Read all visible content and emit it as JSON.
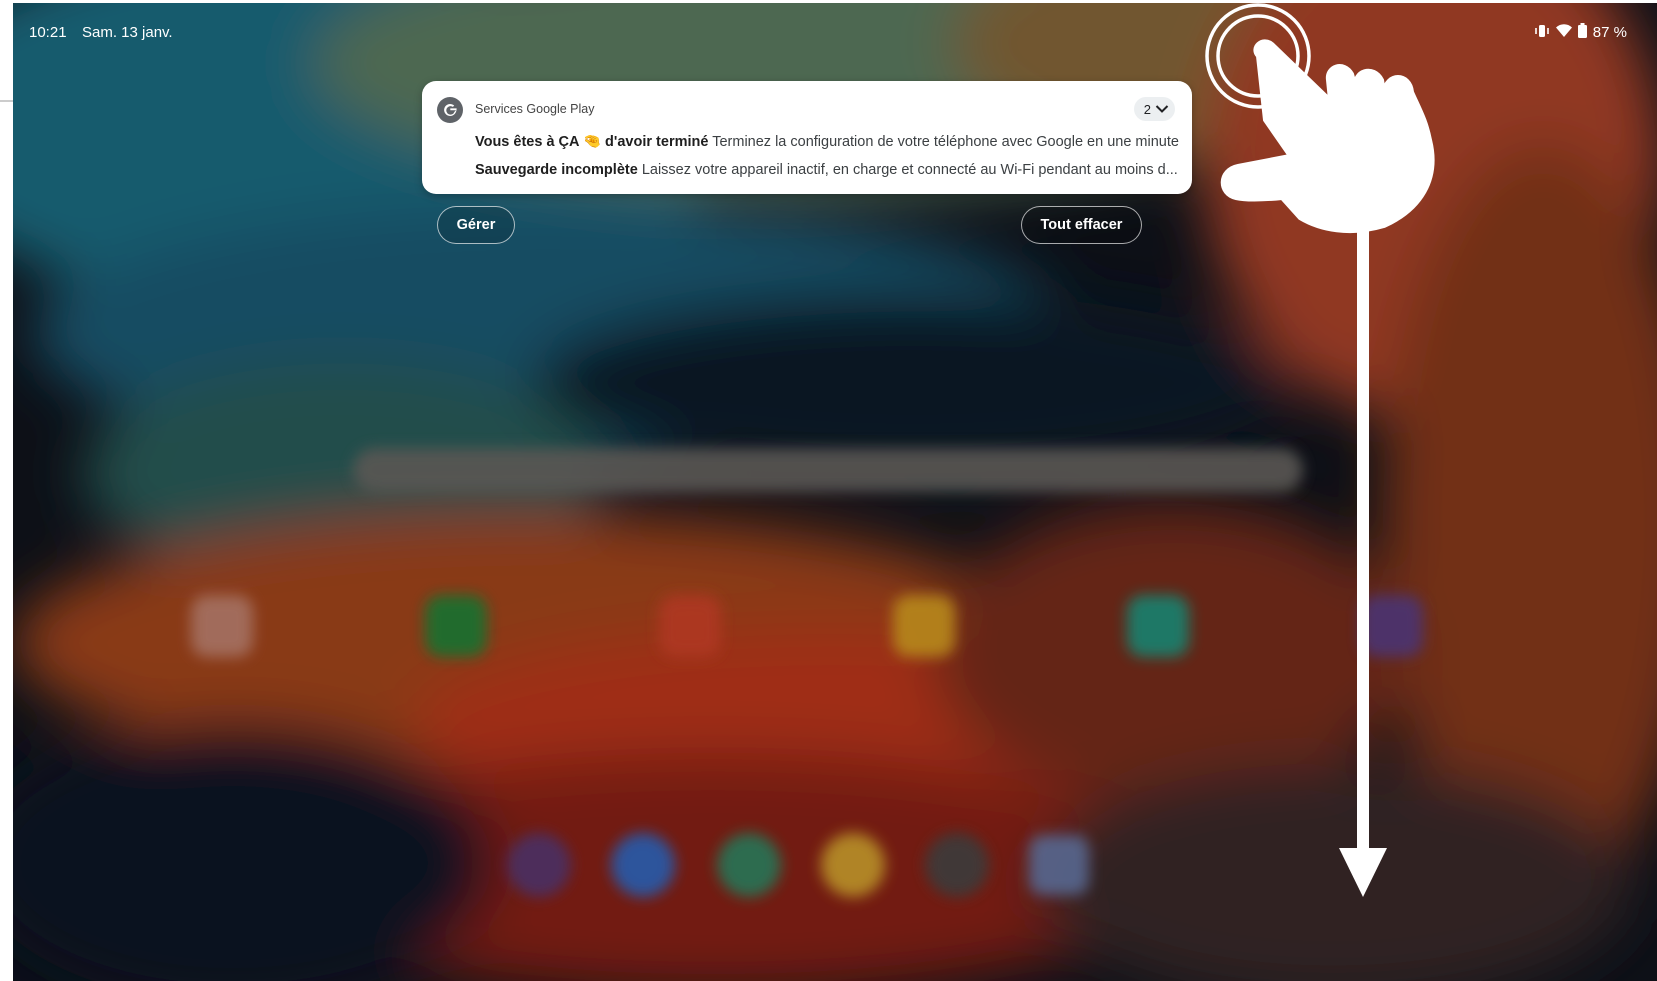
{
  "status_bar": {
    "time": "10:21",
    "date": "Sam. 13 janv.",
    "battery": "87 %",
    "icons": [
      "vibrate-icon",
      "wifi-icon",
      "battery-icon"
    ]
  },
  "notification": {
    "app_name": "Services Google Play",
    "count": "2",
    "line1_title": "Vous êtes à ÇA 🤏 d'avoir terminé",
    "line1_text": "Terminez la configuration de votre téléphone avec Google en une minute",
    "line2_title": "Sauvegarde incomplète",
    "line2_text": "Laissez votre appareil inactif, en charge et connecté au Wi-Fi pendant au moins d..."
  },
  "actions": {
    "manage_label": "Gérer",
    "clear_label": "Tout effacer"
  },
  "gesture": {
    "type": "swipe-down",
    "icons": [
      "hand-pointer-icon",
      "tap-ripple-icon",
      "arrow-down-icon"
    ]
  },
  "colors": {
    "accent_icon_bg": "#5f6368",
    "notification_bg": "#ffffff"
  }
}
